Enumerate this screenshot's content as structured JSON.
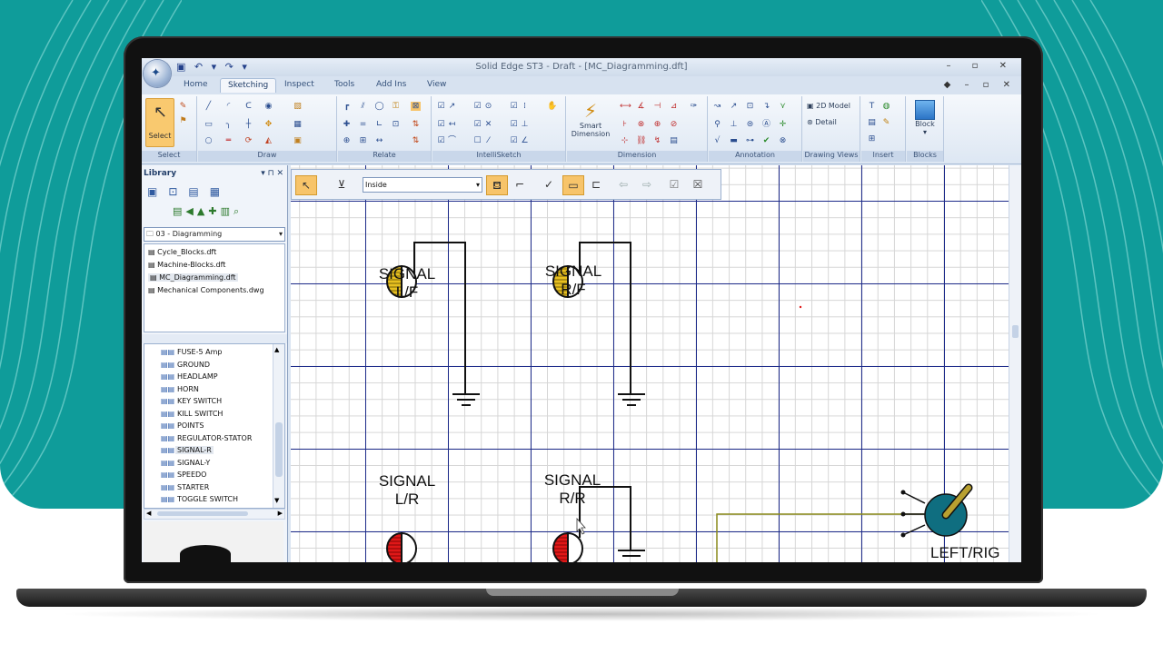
{
  "app": {
    "title": "Solid Edge ST3 - Draft - [MC_Diagramming.dft]",
    "orb_icon": "app-orb-icon",
    "qat": "▣ ↶ ▾ ↷ ▾"
  },
  "tabs": [
    "Home",
    "Sketching",
    "Inspect",
    "Tools",
    "Add Ins",
    "View"
  ],
  "active_tab": "Sketching",
  "ribbon": {
    "groups": [
      "Select",
      "Draw",
      "Relate",
      "IntelliSketch",
      "Dimension",
      "Annotation",
      "Drawing Views",
      "Insert",
      "Blocks"
    ],
    "select_label": "Select",
    "smart_dimension_label": "Smart Dimension",
    "model_2d_label": "2D Model",
    "detail_label": "Detail",
    "block_label": "Block"
  },
  "library": {
    "title": "Library",
    "pin_controls": "▾ ⊓ ✕",
    "folder": "03 - Diagramming",
    "files": [
      "Cycle_Blocks.dft",
      "Machine-Blocks.dft",
      "MC_Diagramming.dft",
      "Mechanical Components.dwg"
    ],
    "selected_file": "MC_Diagramming.dft",
    "blocks": [
      "FUSE-5 Amp",
      "GROUND",
      "HEADLAMP",
      "HORN",
      "KEY SWITCH",
      "KILL SWITCH",
      "POINTS",
      "REGULATOR-STATOR",
      "SIGNAL-R",
      "SIGNAL-Y",
      "SPEEDO",
      "STARTER",
      "TOGGLE SWITCH"
    ],
    "selected_block": "SIGNAL-R"
  },
  "command_bar": {
    "combo_value": "Inside"
  },
  "drawing": {
    "labels": {
      "signal_lf": [
        "SIGNAL",
        "L/F"
      ],
      "signal_rf": [
        "SIGNAL",
        "R/F"
      ],
      "signal_lr": [
        "SIGNAL",
        "L/R"
      ],
      "signal_rr": [
        "SIGNAL",
        "R/R"
      ],
      "left_right": "LEFT/RIG"
    },
    "colors": {
      "yellow": "#e8c020",
      "red": "#e01818",
      "switch": "#0f6e80",
      "handle": "#b8a030",
      "wire": "#111111",
      "olive_wire": "#8a8a1a"
    }
  },
  "colors": {
    "background_teal": "#0f9c9a",
    "active_button": "#f7c46a"
  }
}
